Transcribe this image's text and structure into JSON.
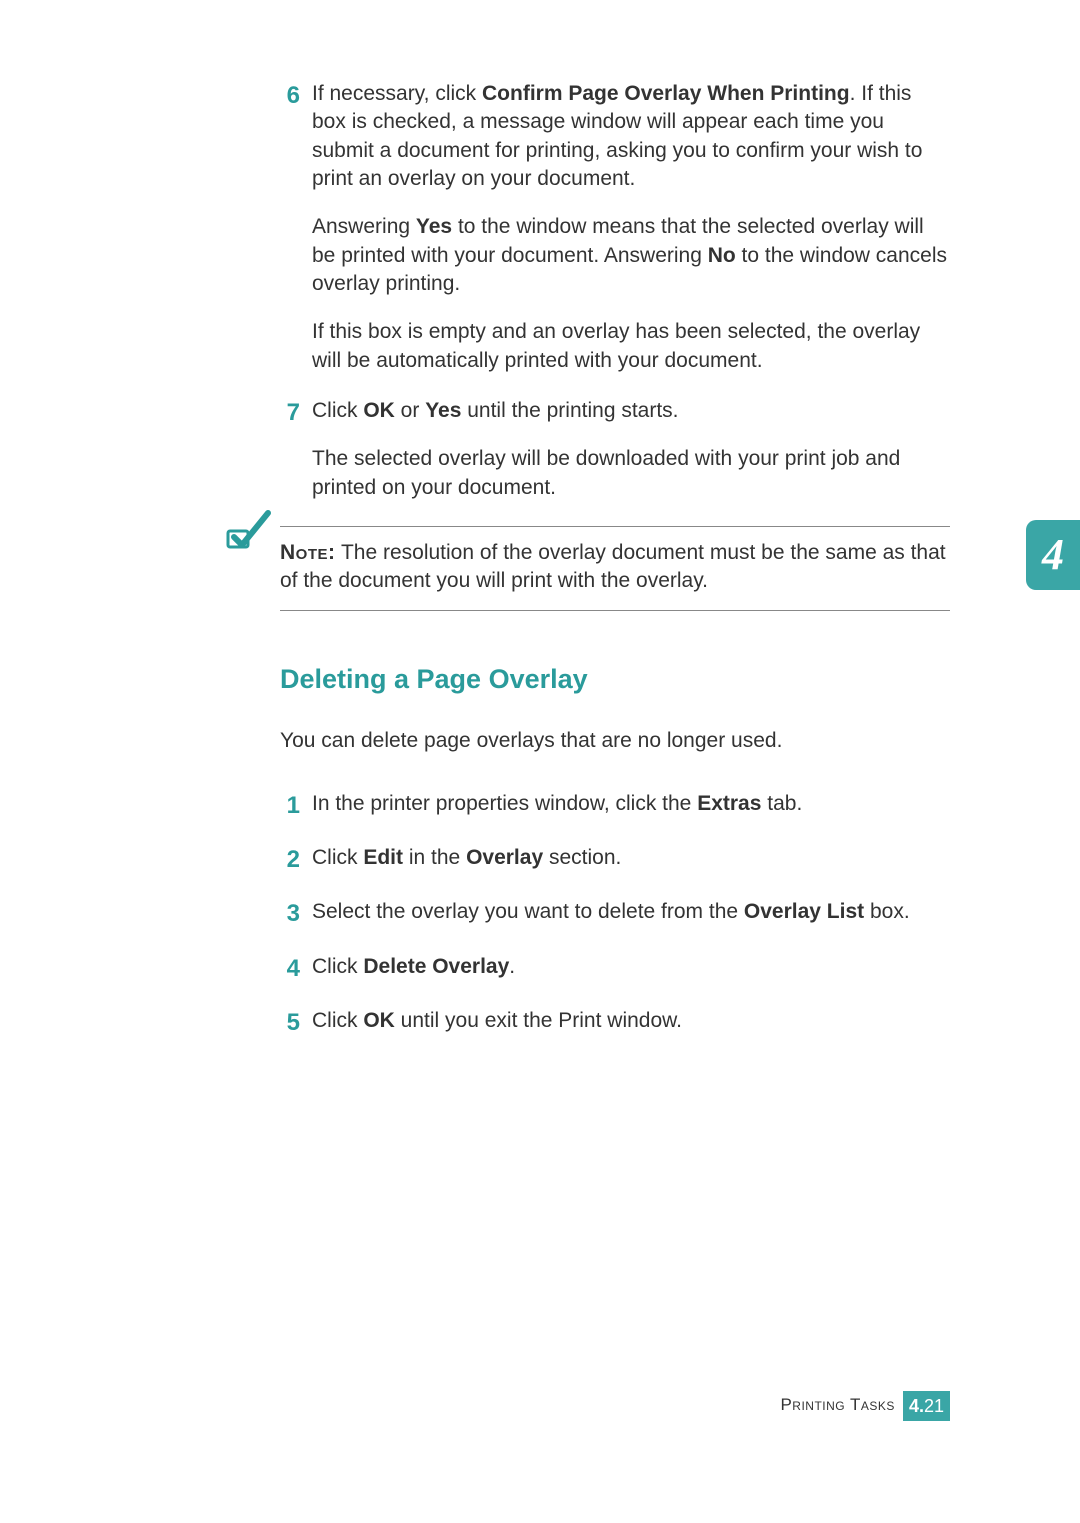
{
  "steps_a": [
    {
      "num": "6",
      "paras": [
        [
          {
            "t": "If necessary, click "
          },
          {
            "t": "Confirm Page Overlay When Printing",
            "b": true
          },
          {
            "t": ". If this box is checked, a message window will appear each time you submit a document for printing, asking you to confirm your wish to print an overlay on your document."
          }
        ],
        [
          {
            "t": "Answering "
          },
          {
            "t": "Yes",
            "b": true
          },
          {
            "t": " to the window means that the selected overlay will be printed with your document. Answering "
          },
          {
            "t": "No",
            "b": true
          },
          {
            "t": " to the window cancels overlay printing."
          }
        ],
        [
          {
            "t": "If this box is empty and an overlay has been selected, the overlay will be automatically printed with your document."
          }
        ]
      ]
    },
    {
      "num": "7",
      "paras": [
        [
          {
            "t": "Click "
          },
          {
            "t": "OK",
            "b": true
          },
          {
            "t": " or "
          },
          {
            "t": "Yes",
            "b": true
          },
          {
            "t": " until the printing starts."
          }
        ],
        [
          {
            "t": "The selected overlay will be downloaded with your print job and printed on your document."
          }
        ]
      ]
    }
  ],
  "note": {
    "label": "Note:",
    "text": " The resolution of the overlay document must be the same as that of the document you will print with the overlay."
  },
  "section_heading": "Deleting a Page Overlay",
  "section_intro": "You can delete page overlays that are no longer used.",
  "steps_b": [
    {
      "num": "1",
      "paras": [
        [
          {
            "t": "In the printer properties window, click the "
          },
          {
            "t": "Extras",
            "b": true
          },
          {
            "t": " tab."
          }
        ]
      ]
    },
    {
      "num": "2",
      "paras": [
        [
          {
            "t": "Click "
          },
          {
            "t": "Edit",
            "b": true
          },
          {
            "t": " in the "
          },
          {
            "t": "Overlay",
            "b": true
          },
          {
            "t": " section."
          }
        ]
      ]
    },
    {
      "num": "3",
      "paras": [
        [
          {
            "t": "Select the overlay you want to delete from the "
          },
          {
            "t": "Overlay List",
            "b": true
          },
          {
            "t": " box."
          }
        ]
      ]
    },
    {
      "num": "4",
      "paras": [
        [
          {
            "t": "Click "
          },
          {
            "t": "Delete Overlay",
            "b": true
          },
          {
            "t": "."
          }
        ]
      ]
    },
    {
      "num": "5",
      "paras": [
        [
          {
            "t": "Click "
          },
          {
            "t": "OK",
            "b": true
          },
          {
            "t": " until you exit the Print window."
          }
        ]
      ]
    }
  ],
  "chapter_tab": "4",
  "footer": {
    "title": "Printing Tasks",
    "chapter": "4.",
    "page": "21"
  }
}
